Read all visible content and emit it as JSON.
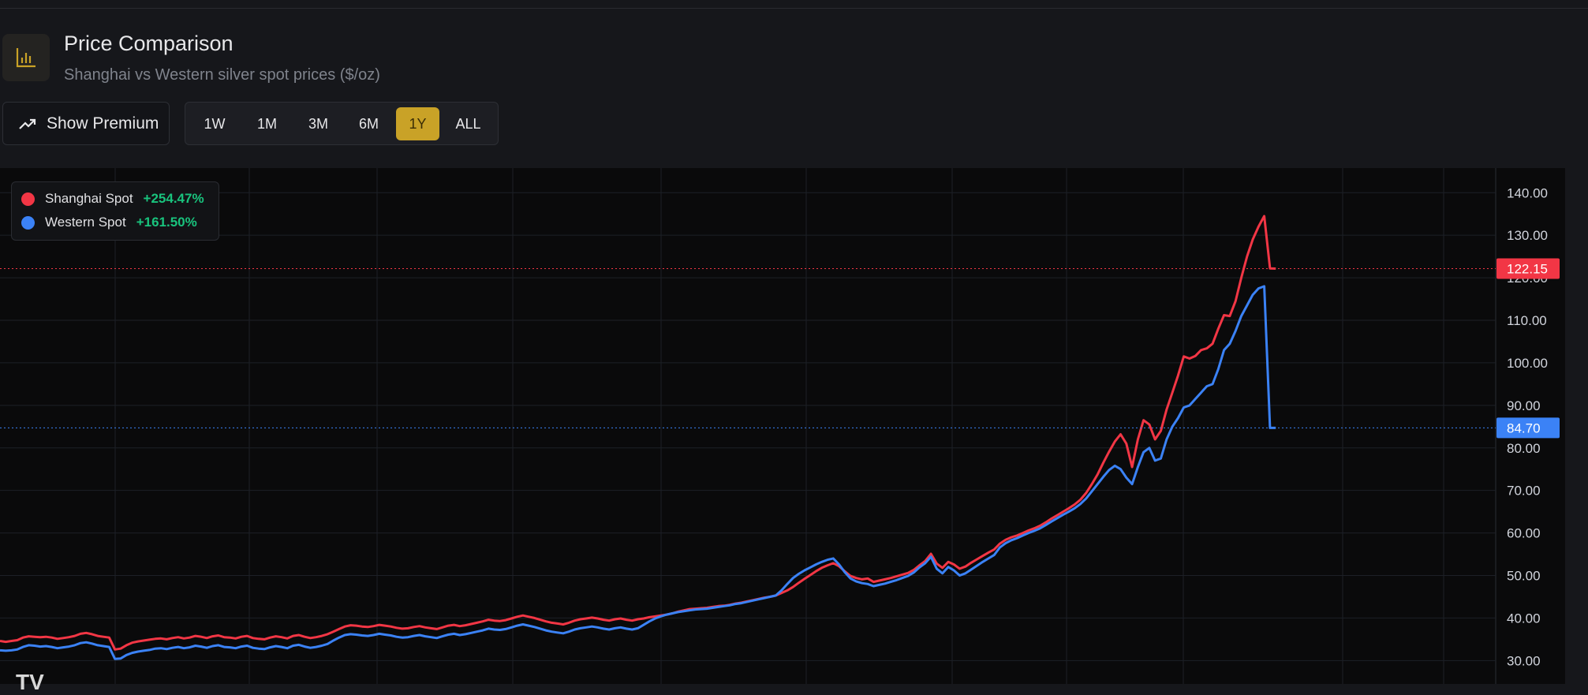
{
  "header": {
    "icon": "bar-chart-icon",
    "title": "Price Comparison",
    "subtitle": "Shanghai vs Western silver spot prices ($/oz)"
  },
  "toolbar": {
    "premium_icon": "trending-up-icon",
    "premium_label": "Show Premium",
    "ranges": [
      "1W",
      "1M",
      "3M",
      "6M",
      "1Y",
      "ALL"
    ],
    "active_range": "1Y"
  },
  "legend": {
    "items": [
      {
        "label": "Shanghai Spot",
        "change": "+254.47%",
        "color": "#f23645"
      },
      {
        "label": "Western Spot",
        "change": "+161.50%",
        "color": "#3b82f6"
      }
    ]
  },
  "colors": {
    "positive": "#19c37d",
    "accent": "#c9a227",
    "background": "#0a0a0b"
  },
  "chart_data": {
    "type": "line",
    "x": [
      0,
      1,
      2,
      3,
      4,
      5,
      6,
      7,
      8,
      9,
      10,
      11,
      12,
      13,
      14,
      15,
      16,
      17,
      18,
      19,
      20,
      21,
      22,
      23,
      24,
      25,
      26,
      27,
      28,
      29,
      30,
      31,
      32,
      33,
      34,
      35,
      36,
      37,
      38,
      39,
      40,
      41,
      42,
      43,
      44,
      45,
      46,
      47,
      48,
      49,
      50,
      51,
      52,
      53,
      54,
      55,
      56,
      57,
      58,
      59,
      60,
      61,
      62,
      63,
      64,
      65,
      66,
      67,
      68,
      69,
      70,
      71,
      72,
      73,
      74,
      75,
      76,
      77,
      78,
      79,
      80,
      81,
      82,
      83,
      84,
      85,
      86,
      87,
      88,
      89,
      90,
      91,
      92,
      93,
      94,
      95,
      96,
      97,
      98,
      99,
      100,
      101,
      102,
      103,
      104,
      105,
      106,
      107,
      108,
      109,
      110,
      111,
      112,
      113,
      114,
      115,
      116,
      117,
      118,
      119,
      120,
      121,
      122,
      123,
      124,
      125,
      126,
      127,
      128,
      129,
      130,
      131,
      132,
      133,
      134,
      135,
      136,
      137,
      138,
      139,
      140,
      141,
      142,
      143,
      144,
      145,
      146,
      147,
      148,
      149,
      150,
      151,
      152,
      153,
      154,
      155,
      156,
      157,
      158,
      159,
      160,
      161,
      162,
      163,
      164,
      165,
      166,
      167,
      168,
      169,
      170,
      171,
      172,
      173,
      174,
      175,
      176,
      177,
      178,
      179,
      180,
      181,
      182,
      183,
      184,
      185,
      186,
      187,
      188,
      189,
      190,
      191,
      192,
      193,
      194,
      195,
      196,
      197,
      198,
      199,
      200,
      201,
      202,
      203,
      204,
      205,
      206,
      207,
      208,
      209,
      210,
      211,
      212,
      213,
      214,
      215,
      216,
      217,
      218,
      219,
      220,
      221,
      222,
      223,
      224,
      225,
      226,
      227,
      228,
      229,
      230,
      231,
      232,
      233,
      234,
      235,
      236,
      237,
      238,
      239,
      240,
      241,
      242,
      243,
      244,
      245,
      246,
      247,
      248,
      249,
      250,
      251,
      252,
      253,
      254,
      255,
      256,
      257,
      258,
      259,
      260
    ],
    "series": [
      {
        "name": "Shanghai Spot",
        "color": "#f23645",
        "last_value": "122.15",
        "values": [
          34.6,
          34.4,
          34.6,
          34.8,
          35.4,
          35.7,
          35.6,
          35.5,
          35.6,
          35.4,
          35.1,
          35.3,
          35.5,
          35.8,
          36.3,
          36.5,
          36.2,
          35.8,
          35.6,
          35.4,
          32.6,
          32.8,
          33.6,
          34.2,
          34.5,
          34.7,
          34.9,
          35.1,
          35.2,
          35.0,
          35.3,
          35.5,
          35.2,
          35.4,
          35.8,
          35.6,
          35.3,
          35.7,
          35.9,
          35.5,
          35.4,
          35.2,
          35.6,
          35.8,
          35.3,
          35.1,
          35.0,
          35.4,
          35.7,
          35.5,
          35.2,
          35.8,
          36.0,
          35.6,
          35.3,
          35.5,
          35.8,
          36.2,
          36.8,
          37.4,
          38.0,
          38.3,
          38.2,
          38.0,
          37.9,
          38.1,
          38.4,
          38.2,
          38.0,
          37.7,
          37.5,
          37.6,
          37.9,
          38.1,
          37.8,
          37.6,
          37.4,
          37.8,
          38.2,
          38.4,
          38.1,
          38.3,
          38.6,
          38.9,
          39.2,
          39.6,
          39.4,
          39.3,
          39.5,
          39.9,
          40.3,
          40.6,
          40.3,
          40.0,
          39.6,
          39.2,
          38.9,
          38.7,
          38.5,
          38.9,
          39.4,
          39.7,
          39.9,
          40.1,
          39.9,
          39.6,
          39.4,
          39.7,
          39.9,
          39.6,
          39.4,
          39.7,
          39.9,
          40.2,
          40.4,
          40.6,
          40.8,
          41.1,
          41.5,
          41.8,
          42.1,
          42.2,
          42.3,
          42.4,
          42.6,
          42.8,
          42.9,
          43.1,
          43.4,
          43.6,
          43.9,
          44.2,
          44.5,
          44.8,
          45.0,
          45.3,
          45.9,
          46.5,
          47.3,
          48.3,
          49.2,
          50.1,
          51.0,
          51.8,
          52.4,
          52.9,
          52.2,
          51.0,
          49.9,
          49.4,
          49.1,
          49.3,
          48.5,
          48.8,
          49.1,
          49.4,
          49.8,
          50.2,
          50.6,
          51.3,
          52.4,
          53.4,
          55.1,
          52.8,
          51.8,
          53.2,
          52.6,
          51.6,
          52.1,
          53.0,
          53.8,
          54.6,
          55.4,
          56.1,
          57.5,
          58.4,
          59.0,
          59.4,
          60.0,
          60.6,
          61.1,
          61.7,
          62.5,
          63.4,
          64.2,
          65.0,
          65.8,
          66.7,
          67.8,
          69.4,
          71.5,
          73.8,
          76.5,
          79.1,
          81.5,
          83.2,
          81.0,
          75.5,
          82.0,
          86.5,
          85.5,
          82.0,
          84.0,
          89.0,
          93.0,
          97.0,
          101.5,
          101.0,
          101.6,
          103.0,
          103.4,
          104.5,
          108.0,
          111.2,
          111.0,
          114.5,
          120.0,
          125.0,
          129.0,
          132.0,
          134.5,
          122.2,
          122.15
        ],
        "values_note": "read off chart"
      },
      {
        "name": "Western Spot",
        "color": "#3b82f6",
        "last_value": "84.70",
        "values": [
          32.4,
          32.3,
          32.4,
          32.6,
          33.2,
          33.6,
          33.5,
          33.3,
          33.4,
          33.2,
          32.9,
          33.1,
          33.3,
          33.6,
          34.1,
          34.3,
          34.0,
          33.6,
          33.4,
          33.2,
          30.4,
          30.5,
          31.3,
          31.8,
          32.1,
          32.3,
          32.5,
          32.8,
          32.9,
          32.7,
          33.0,
          33.2,
          32.9,
          33.1,
          33.5,
          33.3,
          33.0,
          33.4,
          33.6,
          33.2,
          33.1,
          32.9,
          33.3,
          33.5,
          33.0,
          32.8,
          32.7,
          33.1,
          33.4,
          33.2,
          32.9,
          33.5,
          33.7,
          33.3,
          33.0,
          33.2,
          33.5,
          33.9,
          34.7,
          35.4,
          36.0,
          36.2,
          36.1,
          35.9,
          35.8,
          36.0,
          36.3,
          36.1,
          35.9,
          35.6,
          35.4,
          35.5,
          35.8,
          36.0,
          35.7,
          35.5,
          35.3,
          35.7,
          36.1,
          36.3,
          36.0,
          36.2,
          36.5,
          36.8,
          37.1,
          37.5,
          37.3,
          37.2,
          37.4,
          37.8,
          38.2,
          38.5,
          38.2,
          37.9,
          37.5,
          37.1,
          36.8,
          36.6,
          36.4,
          36.8,
          37.3,
          37.6,
          37.8,
          38.0,
          37.8,
          37.5,
          37.3,
          37.6,
          37.8,
          37.5,
          37.3,
          37.6,
          38.4,
          39.2,
          39.9,
          40.4,
          40.8,
          41.1,
          41.4,
          41.6,
          41.8,
          42.0,
          42.1,
          42.2,
          42.4,
          42.6,
          42.8,
          43.0,
          43.3,
          43.5,
          43.8,
          44.1,
          44.4,
          44.7,
          45.0,
          45.3,
          46.5,
          48.0,
          49.4,
          50.4,
          51.2,
          51.9,
          52.6,
          53.2,
          53.7,
          54.0,
          52.6,
          50.8,
          49.3,
          48.6,
          48.2,
          48.0,
          47.5,
          47.8,
          48.1,
          48.5,
          48.9,
          49.4,
          49.9,
          50.7,
          51.9,
          52.9,
          54.4,
          51.6,
          50.5,
          52.0,
          51.2,
          50.0,
          50.5,
          51.4,
          52.3,
          53.2,
          54.0,
          54.8,
          56.6,
          57.6,
          58.3,
          58.8,
          59.4,
          60.0,
          60.5,
          61.1,
          61.9,
          62.7,
          63.5,
          64.3,
          65.0,
          65.8,
          66.8,
          68.1,
          69.8,
          71.5,
          73.2,
          74.8,
          75.8,
          75.0,
          73.0,
          71.5,
          75.5,
          79.0,
          80.0,
          77.0,
          77.5,
          82.0,
          85.0,
          87.0,
          89.5,
          90.0,
          91.5,
          93.0,
          94.5,
          95.0,
          98.5,
          103.0,
          104.5,
          107.5,
          111.0,
          113.5,
          116.0,
          117.5,
          118.0,
          84.7,
          84.7
        ],
        "values_note": "read off chart"
      }
    ],
    "y_ticks": [
      "30.00",
      "40.00",
      "50.00",
      "60.00",
      "70.00",
      "80.00",
      "90.00",
      "100.00",
      "110.00",
      "120.00",
      "130.00",
      "140.00"
    ],
    "ylim": [
      24.5,
      145.8
    ],
    "grid": true,
    "legend_position": "top-left",
    "price_lines": [
      {
        "series": "Shanghai Spot",
        "value": 122.15,
        "label": "122.15",
        "color": "#f23645"
      },
      {
        "series": "Western Spot",
        "value": 84.7,
        "label": "84.70",
        "color": "#3b82f6"
      }
    ],
    "watermark": "TV"
  }
}
